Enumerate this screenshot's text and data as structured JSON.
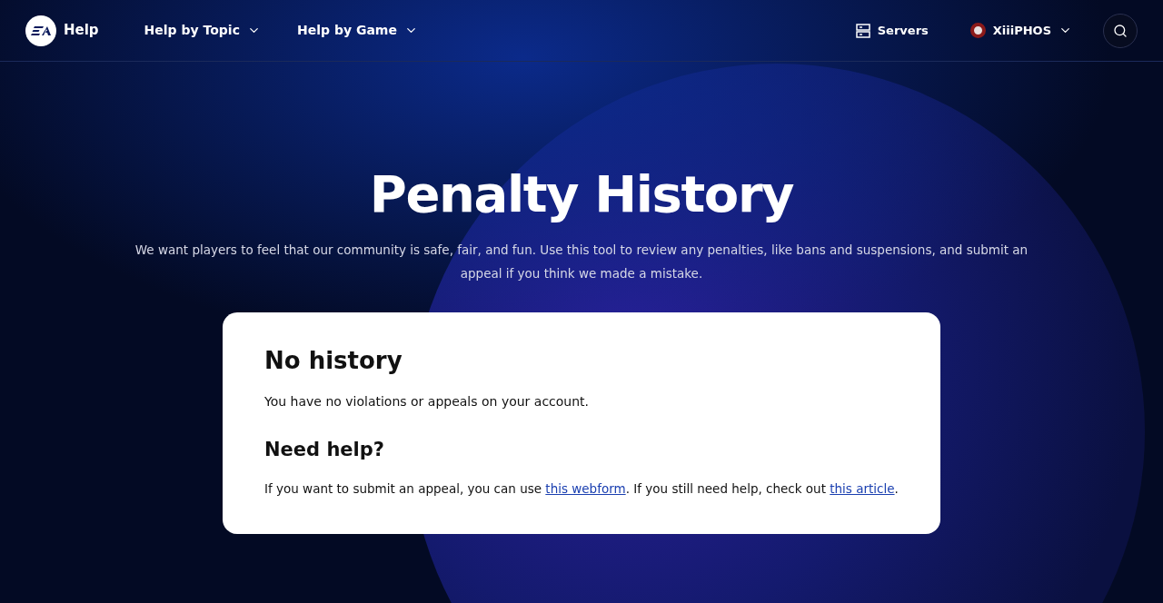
{
  "nav": {
    "brand": "Help",
    "menus": [
      {
        "label": "Help by Topic"
      },
      {
        "label": "Help by Game"
      }
    ],
    "servers": "Servers",
    "user": "XiiiPHOS"
  },
  "hero": {
    "title": "Penalty History",
    "intro": "We want players to feel that our community is safe, fair, and fun. Use this tool to review any penalties, like bans and suspensions, and submit an appeal if you think we made a mistake."
  },
  "card": {
    "heading": "No history",
    "status": "You have no violations or appeals on your account.",
    "help_heading": "Need help?",
    "help_text": [
      {
        "kind": "text",
        "text": "If you want to submit an appeal, you can use "
      },
      {
        "kind": "link",
        "text": "this webform"
      },
      {
        "kind": "text",
        "text": ". If you still need help, check out "
      },
      {
        "kind": "link",
        "text": "this article"
      },
      {
        "kind": "text",
        "text": "."
      }
    ]
  }
}
